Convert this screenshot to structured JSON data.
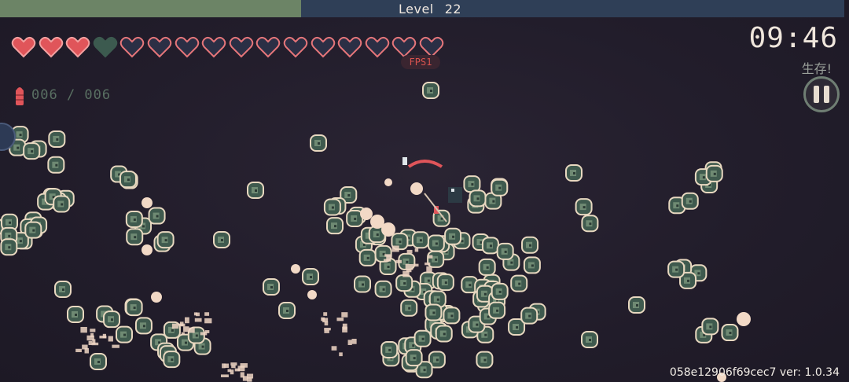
{
  "hud": {
    "level_label": "Level",
    "level_value": "22",
    "xp_progress": 0.357,
    "health": {
      "filled_hearts": 3,
      "empty_heart_green": 1,
      "outline_hearts": 12
    },
    "fps_label": "FPS1",
    "ammo": "006 / 006",
    "timer": "09:46",
    "objective": "生存!",
    "version": "058e12906f69cec7 ver: 1.0.34"
  },
  "colors": {
    "background": "#221d2b",
    "xp_fill": "#6c8466",
    "xp_track": "#2f3f57",
    "heart_red": "#e0555a",
    "enemy_fill": "#3f5a4e",
    "enemy_outline": "#e8d8c0",
    "projectile": "#f2d9c6"
  },
  "icons": [
    "heart-icon",
    "bullet-icon",
    "pause-icon"
  ]
}
